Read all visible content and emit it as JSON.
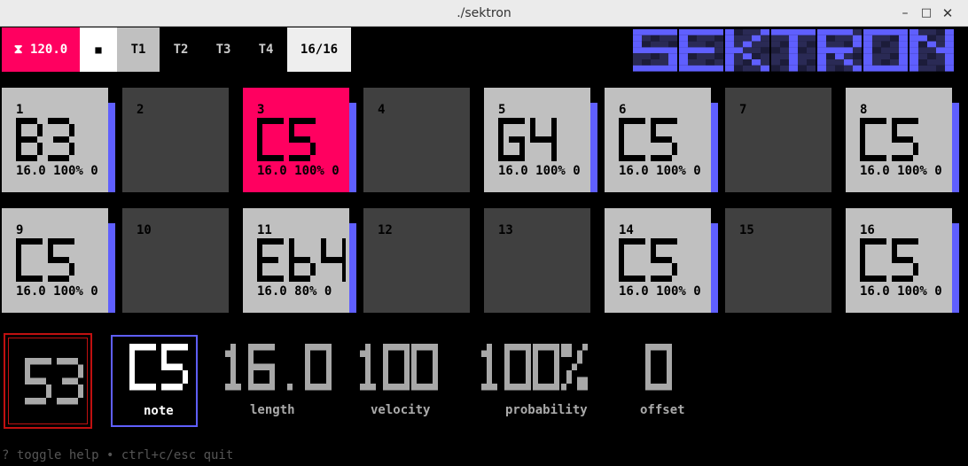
{
  "window": {
    "title": "./sektron",
    "minimize_icon": "–",
    "maximize_icon": "□",
    "close_icon": "✕"
  },
  "toolbar": {
    "tempo": "⧗ 120.0",
    "stop_icon": "■",
    "tracks": [
      "T1",
      "T2",
      "T3",
      "T4"
    ],
    "active_track": 0,
    "pages": "16/16"
  },
  "logo": {
    "text": "SEKTRON",
    "color": "#5f5fff"
  },
  "colors": {
    "step_on": "#c0c0c0",
    "step_off": "#404040",
    "step_current": "#ff0060",
    "accent": "#5f5fff"
  },
  "steps": [
    {
      "num": "1",
      "active": true,
      "current": false,
      "note": "B3",
      "meta": "16.0 100% 0"
    },
    {
      "num": "2",
      "active": false,
      "current": false,
      "note": "",
      "meta": ""
    },
    {
      "num": "3",
      "active": true,
      "current": true,
      "note": "C5",
      "meta": "16.0 100% 0"
    },
    {
      "num": "4",
      "active": false,
      "current": false,
      "note": "",
      "meta": ""
    },
    {
      "num": "5",
      "active": true,
      "current": false,
      "note": "G4",
      "meta": "16.0 100% 0"
    },
    {
      "num": "6",
      "active": true,
      "current": false,
      "note": "C5",
      "meta": "16.0 100% 0"
    },
    {
      "num": "7",
      "active": false,
      "current": false,
      "note": "",
      "meta": ""
    },
    {
      "num": "8",
      "active": true,
      "current": false,
      "note": "C5",
      "meta": "16.0 100% 0"
    },
    {
      "num": "9",
      "active": true,
      "current": false,
      "note": "C5",
      "meta": "16.0 100% 0"
    },
    {
      "num": "10",
      "active": false,
      "current": false,
      "note": "",
      "meta": ""
    },
    {
      "num": "11",
      "active": true,
      "current": false,
      "note": "Eb4",
      "meta": "16.0 80% 0"
    },
    {
      "num": "12",
      "active": false,
      "current": false,
      "note": "",
      "meta": ""
    },
    {
      "num": "13",
      "active": false,
      "current": false,
      "note": "",
      "meta": ""
    },
    {
      "num": "14",
      "active": true,
      "current": false,
      "note": "C5",
      "meta": "16.0 100% 0"
    },
    {
      "num": "15",
      "active": false,
      "current": false,
      "note": "",
      "meta": ""
    },
    {
      "num": "16",
      "active": true,
      "current": false,
      "note": "C5",
      "meta": "16.0 100% 0"
    }
  ],
  "params": {
    "pattern": "53",
    "note": {
      "value": "C5",
      "label": "note"
    },
    "length": {
      "value": "16.0",
      "label": "length"
    },
    "velocity": {
      "value": "100",
      "label": "velocity"
    },
    "probability": {
      "value": "100%",
      "label": "probability"
    },
    "offset": {
      "value": "0",
      "label": "offset"
    }
  },
  "help": "? toggle help • ctrl+c/esc quit"
}
